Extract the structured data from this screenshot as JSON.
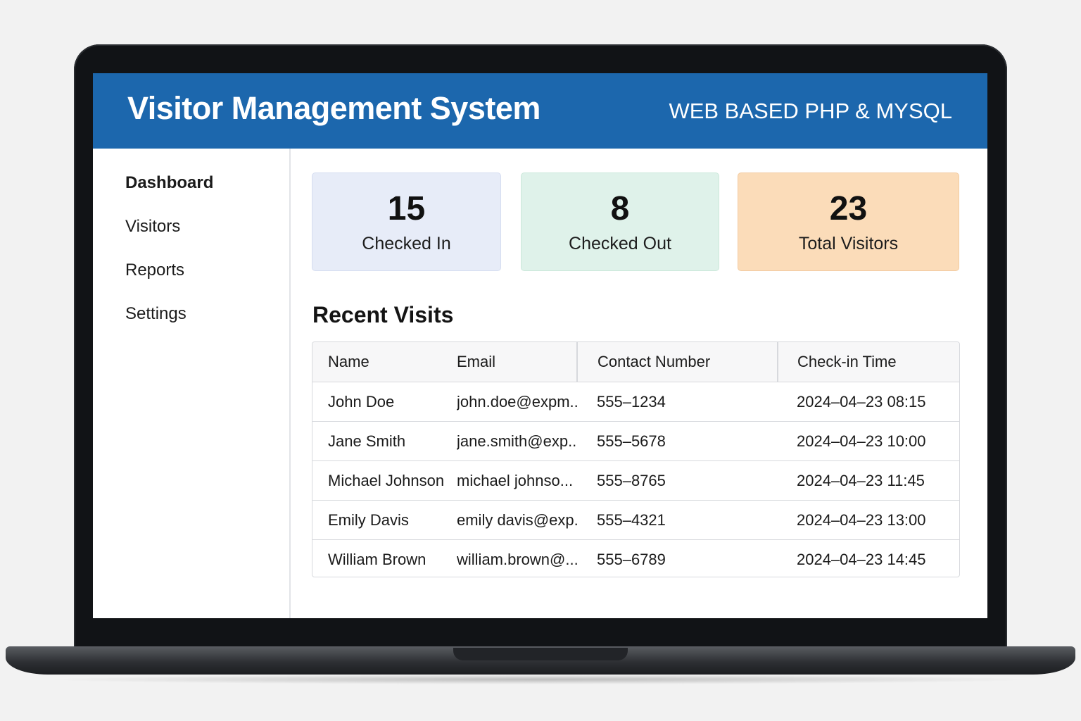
{
  "header": {
    "title": "Visitor Management System",
    "subtitle": "WEB BASED PHP & MYSQL"
  },
  "sidebar": {
    "items": [
      {
        "label": "Dashboard",
        "active": true
      },
      {
        "label": "Visitors",
        "active": false
      },
      {
        "label": "Reports",
        "active": false
      },
      {
        "label": "Settings",
        "active": false
      }
    ]
  },
  "stats": [
    {
      "value": "15",
      "label": "Checked In",
      "color": "#e7ecf8"
    },
    {
      "value": "8",
      "label": "Checked Out",
      "color": "#dff2ea"
    },
    {
      "value": "23",
      "label": "Total Visitors",
      "color": "#fbdcb9"
    }
  ],
  "recent_visits": {
    "title": "Recent Visits",
    "columns": [
      "Name",
      "Email",
      "Contact Number",
      "Check-in Time"
    ],
    "rows": [
      [
        "John Doe",
        "john.doe@expm...",
        "555–1234",
        "2024–04–23 08:15"
      ],
      [
        "Jane Smith",
        "jane.smith@exp...",
        "555–5678",
        "2024–04–23 10:00"
      ],
      [
        "Michael Johnson",
        "michael johnso...",
        "555–8765",
        "2024–04–23 11:45"
      ],
      [
        "Emily Davis",
        "emily davis@exp...",
        "555–4321",
        "2024–04–23 13:00"
      ],
      [
        "William Brown",
        "william.brown@...",
        "555–6789",
        "2024–04–23 14:45"
      ]
    ]
  },
  "colors": {
    "header": "#1c67ad",
    "laptop_frame": "#111316"
  }
}
